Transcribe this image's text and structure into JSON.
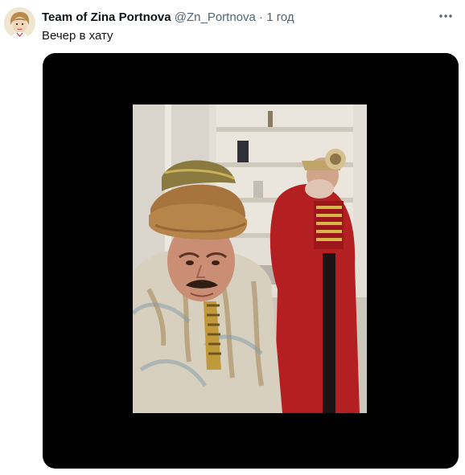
{
  "tweet": {
    "display_name": "Team of Zina Portnova",
    "handle": "@Zn_Portnova",
    "separator": "·",
    "time": "1 год",
    "text": "Вечер в хату",
    "more_icon": "more-horizontal-icon",
    "avatar_icon": "avatar-portrait"
  },
  "colors": {
    "media_background": "#000000",
    "secondary_text": "#536471",
    "primary_text": "#0f1419"
  }
}
